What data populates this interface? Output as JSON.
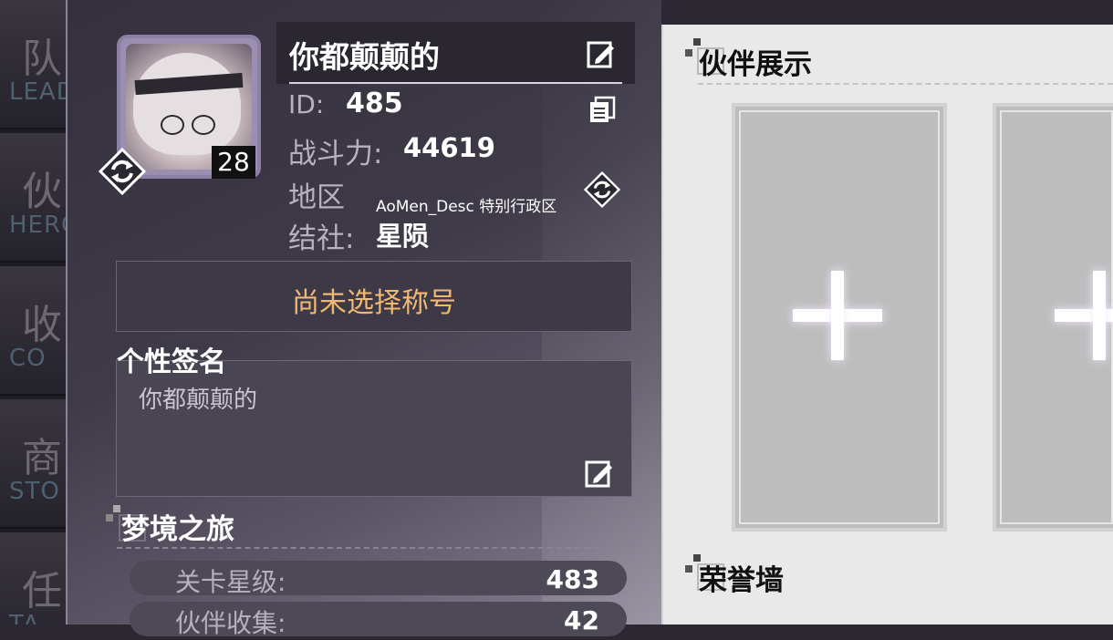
{
  "nav": [
    {
      "big": "队",
      "small": "LEAD"
    },
    {
      "big": "伙",
      "small": "HERO"
    },
    {
      "big": "收",
      "small": "CO"
    },
    {
      "big": "商",
      "small": "STO"
    },
    {
      "big": "任",
      "small": "TA"
    }
  ],
  "profile": {
    "level": "28",
    "name": "你都颠颠的",
    "id_label": "ID:",
    "id_value": "485",
    "power_label": "战斗力:",
    "power_value": "44619",
    "region_label": "地区",
    "region_value": "AoMen_Desc 特别行政区",
    "guild_label": "结社:",
    "guild_value": "星陨",
    "title_text": "尚未选择称号"
  },
  "signature": {
    "heading": "个性签名",
    "text": "你都颠颠的"
  },
  "journey": {
    "heading": "梦境之旅",
    "stats": [
      {
        "label": "关卡星级:",
        "value": "483"
      },
      {
        "label": "伙伴收集:",
        "value": "42"
      }
    ]
  },
  "showcase": {
    "heading": "伙伴展示",
    "honor_heading": "荣誉墙"
  },
  "colors": {
    "title_accent": "#f2b872",
    "panel_bg": "#3f3a48",
    "right_bg": "#e9e9ea"
  }
}
